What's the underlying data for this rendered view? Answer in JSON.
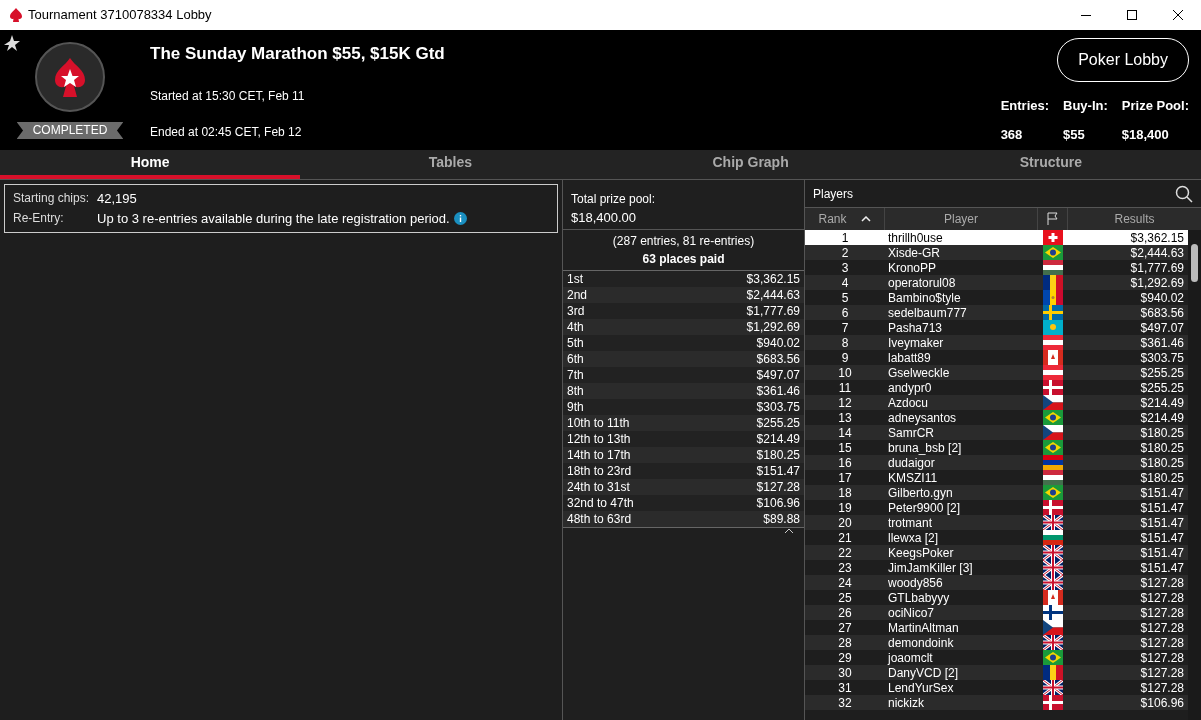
{
  "window": {
    "title": "Tournament 3710078334 Lobby"
  },
  "header": {
    "title": "The Sunday Marathon $55, $15K Gtd",
    "status": "COMPLETED",
    "started": "Started at 15:30 CET, Feb 11",
    "ended": "Ended at 02:45 CET, Feb 12",
    "lobby_button": "Poker Lobby",
    "stats": [
      {
        "label": "Entries:",
        "value": "368"
      },
      {
        "label": "Buy-In:",
        "value": "$55"
      },
      {
        "label": "Prize Pool:",
        "value": "$18,400"
      }
    ]
  },
  "tabs": [
    {
      "label": "Home",
      "selected": true
    },
    {
      "label": "Tables",
      "selected": false
    },
    {
      "label": "Chip Graph",
      "selected": false
    },
    {
      "label": "Structure",
      "selected": false
    }
  ],
  "info": [
    {
      "label": "Starting chips:",
      "value": "42,195",
      "info_icon": false
    },
    {
      "label": "Re-Entry:",
      "value": "Up to 3 re-entries available during the late registration period.",
      "info_icon": true
    }
  ],
  "prizes": {
    "total_label": "Total prize pool:",
    "total": "$18,400.00",
    "entries": "(287 entries, 81 re-entries)",
    "places": "63 places paid",
    "rows": [
      [
        "1st",
        "$3,362.15"
      ],
      [
        "2nd",
        "$2,444.63"
      ],
      [
        "3rd",
        "$1,777.69"
      ],
      [
        "4th",
        "$1,292.69"
      ],
      [
        "5th",
        "$940.02"
      ],
      [
        "6th",
        "$683.56"
      ],
      [
        "7th",
        "$497.07"
      ],
      [
        "8th",
        "$361.46"
      ],
      [
        "9th",
        "$303.75"
      ],
      [
        "10th to 11th",
        "$255.25"
      ],
      [
        "12th to 13th",
        "$214.49"
      ],
      [
        "14th to 17th",
        "$180.25"
      ],
      [
        "18th to 23rd",
        "$151.47"
      ],
      [
        "24th to 31st",
        "$127.28"
      ],
      [
        "32nd to 47th",
        "$106.96"
      ],
      [
        "48th to 63rd",
        "$89.88"
      ]
    ]
  },
  "players": {
    "title": "Players",
    "columns": [
      "Rank",
      "Player",
      "Results"
    ],
    "rows": [
      {
        "rank": "1",
        "name": "thrillh0use",
        "kind": "ch",
        "result": "$3,362.15",
        "selected": true
      },
      {
        "rank": "2",
        "name": "Xisde-GR",
        "kind": "br",
        "result": "$2,444.63",
        "selected": false
      },
      {
        "rank": "3",
        "name": "KronoPP",
        "kind": "hu",
        "result": "$1,777.69",
        "selected": false
      },
      {
        "rank": "4",
        "name": "operatorul08",
        "kind": "ro",
        "result": "$1,292.69",
        "selected": false
      },
      {
        "rank": "5",
        "name": "Bambino$tyle",
        "kind": "md",
        "result": "$940.02",
        "selected": false
      },
      {
        "rank": "6",
        "name": "sedelbaum777",
        "kind": "se",
        "result": "$683.56",
        "selected": false
      },
      {
        "rank": "7",
        "name": "Pasha713",
        "kind": "kz",
        "result": "$497.07",
        "selected": false
      },
      {
        "rank": "8",
        "name": "Iveymaker",
        "kind": "at",
        "result": "$361.46",
        "selected": false
      },
      {
        "rank": "9",
        "name": "labatt89",
        "kind": "ca",
        "result": "$303.75",
        "selected": false
      },
      {
        "rank": "10",
        "name": "Gselweckle",
        "kind": "at",
        "result": "$255.25",
        "selected": false
      },
      {
        "rank": "11",
        "name": "andypr0",
        "kind": "dk",
        "result": "$255.25",
        "selected": false
      },
      {
        "rank": "12",
        "name": "Azdocu",
        "kind": "cz",
        "result": "$214.49",
        "selected": false
      },
      {
        "rank": "13",
        "name": "adneysantos",
        "kind": "br",
        "result": "$214.49",
        "selected": false
      },
      {
        "rank": "14",
        "name": "SamrCR",
        "kind": "cz",
        "result": "$180.25",
        "selected": false
      },
      {
        "rank": "15",
        "name": "bruna_bsb [2]",
        "kind": "br",
        "result": "$180.25",
        "selected": false
      },
      {
        "rank": "16",
        "name": "dudaigor",
        "kind": "am",
        "result": "$180.25",
        "selected": false
      },
      {
        "rank": "17",
        "name": "KMSZI11",
        "kind": "hu",
        "result": "$180.25",
        "selected": false
      },
      {
        "rank": "18",
        "name": "Gilberto.gyn",
        "kind": "br",
        "result": "$151.47",
        "selected": false
      },
      {
        "rank": "19",
        "name": "Peter9900 [2]",
        "kind": "dk",
        "result": "$151.47",
        "selected": false
      },
      {
        "rank": "20",
        "name": "trotmant",
        "kind": "gb",
        "result": "$151.47",
        "selected": false
      },
      {
        "rank": "21",
        "name": "llewxa [2]",
        "kind": "bg",
        "result": "$151.47",
        "selected": false
      },
      {
        "rank": "22",
        "name": "KeegsPoker",
        "kind": "gb",
        "result": "$151.47",
        "selected": false
      },
      {
        "rank": "23",
        "name": "JimJamKiller [3]",
        "kind": "gb",
        "result": "$151.47",
        "selected": false
      },
      {
        "rank": "24",
        "name": "woody856",
        "kind": "gb",
        "result": "$127.28",
        "selected": false
      },
      {
        "rank": "25",
        "name": "GTLbabyyy",
        "kind": "ca",
        "result": "$127.28",
        "selected": false
      },
      {
        "rank": "26",
        "name": "ociNico7",
        "kind": "fi",
        "result": "$127.28",
        "selected": false
      },
      {
        "rank": "27",
        "name": "MartinAltman",
        "kind": "cz",
        "result": "$127.28",
        "selected": false
      },
      {
        "rank": "28",
        "name": "demondoink",
        "kind": "gb",
        "result": "$127.28",
        "selected": false
      },
      {
        "rank": "29",
        "name": "joaomclt",
        "kind": "br",
        "result": "$127.28",
        "selected": false
      },
      {
        "rank": "30",
        "name": "DanyVCD [2]",
        "kind": "ro",
        "result": "$127.28",
        "selected": false
      },
      {
        "rank": "31",
        "name": "LendYurSex",
        "kind": "gb",
        "result": "$127.28",
        "selected": false
      },
      {
        "rank": "32",
        "name": "nickizk",
        "kind": "dk",
        "result": "$106.96",
        "selected": false
      }
    ]
  }
}
